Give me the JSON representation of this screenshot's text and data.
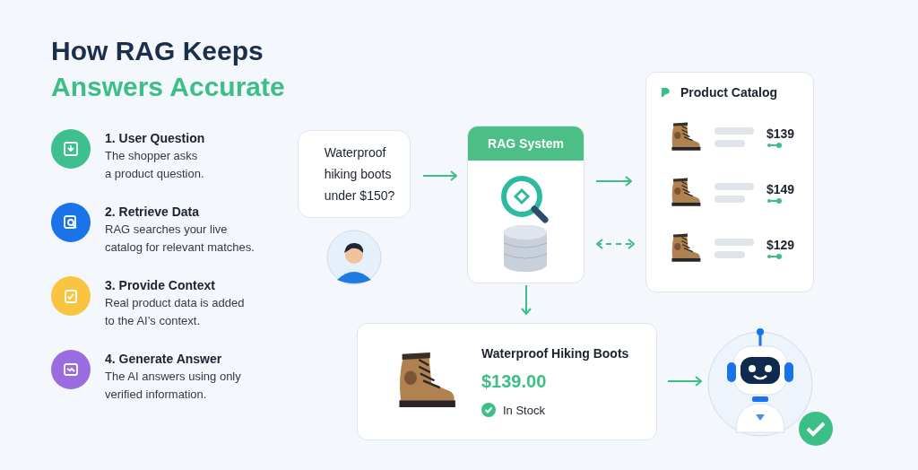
{
  "title": {
    "line_1": "How RAG Keeps",
    "line_2": "Answers Accurate"
  },
  "steps": [
    {
      "heading": "1. User Question",
      "text": "The shopper asks\na product question.",
      "color": "#3dbf8f"
    },
    {
      "heading": "2. Retrieve Data",
      "text": "RAG searches your live\ncatalog for relevant matches.",
      "color": "#1a73e8"
    },
    {
      "heading": "3. Provide Context",
      "text": "Real product data is added\nto the AI’s context.",
      "color": "#f9c440"
    },
    {
      "heading": "4. Generate Answer",
      "text": "The AI answers using only\nverified information.",
      "color": "#9b6ce0"
    }
  ],
  "question": "Waterproof\nhiking boots\nunder $150?",
  "rag_system": {
    "title": "RAG System"
  },
  "catalog": {
    "title": "Product Catalog",
    "items": [
      {
        "price": "$139"
      },
      {
        "price": "$149"
      },
      {
        "price": "$129"
      }
    ]
  },
  "result": {
    "name": "Waterproof Hiking Boots",
    "price": "$139.00",
    "stock": "In Stock"
  }
}
